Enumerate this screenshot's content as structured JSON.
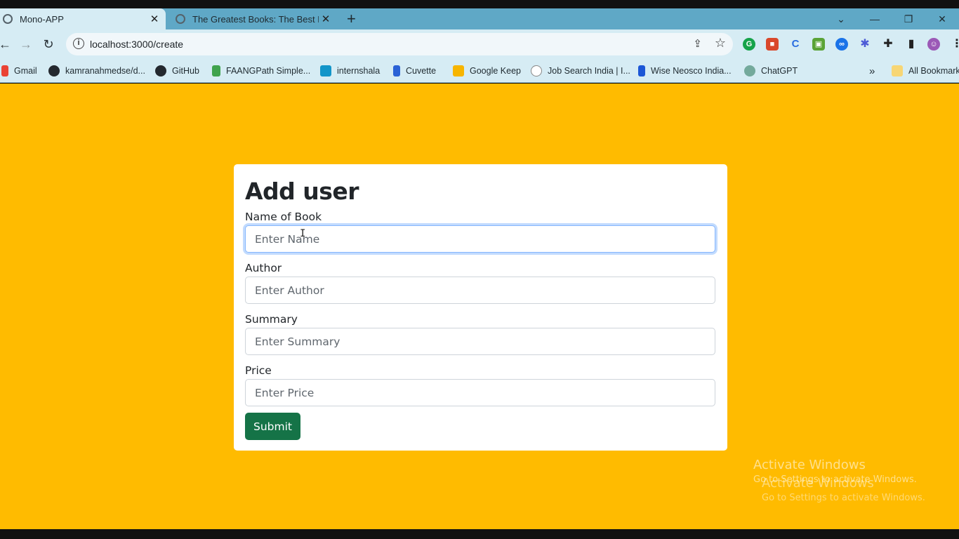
{
  "browser": {
    "tabs": [
      {
        "title": "Mono-APP",
        "active": true
      },
      {
        "title": "The Greatest Books: The Best Bc",
        "active": false
      }
    ],
    "url": "localhost:3000/create",
    "bookmarks": [
      {
        "label": "Gmail",
        "icon": "gmail-icon",
        "color": "#ea4335"
      },
      {
        "label": "kamranahmedse/d...",
        "icon": "github-icon",
        "color": "#24292f"
      },
      {
        "label": "GitHub",
        "icon": "github-icon",
        "color": "#24292f"
      },
      {
        "label": "FAANGPath Simple...",
        "icon": "faangpath-icon",
        "color": "#3fa34d"
      },
      {
        "label": "internshala",
        "icon": "internshala-icon",
        "color": "#1295c9"
      },
      {
        "label": "Cuvette",
        "icon": "cuvette-icon",
        "color": "#2a62d6"
      },
      {
        "label": "Google Keep",
        "icon": "keep-icon",
        "color": "#f7b500"
      },
      {
        "label": "Job Search India | I...",
        "icon": "info-icon",
        "color": "#ffffff"
      },
      {
        "label": "Wise Neosco India...",
        "icon": "wise-icon",
        "color": "#1c57d6"
      },
      {
        "label": "ChatGPT",
        "icon": "chatgpt-icon",
        "color": "#74aa9c"
      }
    ],
    "all_bookmarks": "All Bookmark"
  },
  "form": {
    "title": "Add user",
    "fields": [
      {
        "label": "Name of Book",
        "placeholder": "Enter Name"
      },
      {
        "label": "Author",
        "placeholder": "Enter Author"
      },
      {
        "label": "Summary",
        "placeholder": "Enter Summary"
      },
      {
        "label": "Price",
        "placeholder": "Enter Price"
      }
    ],
    "submit_label": "Submit"
  },
  "watermark": {
    "line1": "Activate Windows",
    "line2": "Go to Settings to activate Windows."
  },
  "colors": {
    "page_bg": "#ffbb00",
    "submit_bg": "#157347",
    "browser_chrome": "#d6ecf4"
  }
}
